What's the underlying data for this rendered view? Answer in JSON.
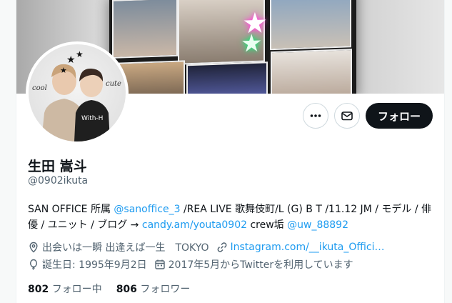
{
  "profile": {
    "name": "生田 嵩斗",
    "handle": "@0902ikuta",
    "bio": {
      "t1": "SAN OFFICE 所属 ",
      "m1": "@sanoffice_3",
      "t2": " /REA LIVE 歌舞伎町/L (G) B T /11.12 JM / モデル / 俳",
      "t3": "優 / ユニット / ブログ → ",
      "link1": "candy.am/youta0902",
      "t4": " crew垢 ",
      "m2": "@uw_88892"
    },
    "location": "出会いは一瞬 出逢えば一生　TOKYO",
    "website": "Instagram.com/__ikuta_Offici…",
    "birthday": "誕生日: 1995年9月2日",
    "joined": "2017年5月からTwitterを利用しています",
    "following_count": "802",
    "following_label": "フォロー中",
    "followers_count": "806",
    "followers_label": "フォロワー"
  },
  "avatar": {
    "cool_text": "cool",
    "cute_text": "cute",
    "shirt_text": "With-H"
  },
  "actions": {
    "more_icon": "more-icon",
    "message_icon": "mail-icon",
    "follow_label": "フォロー"
  },
  "colors": {
    "link": "#1d9bf0",
    "secondary_text": "#536471",
    "follow_button_bg": "#0f1419"
  }
}
